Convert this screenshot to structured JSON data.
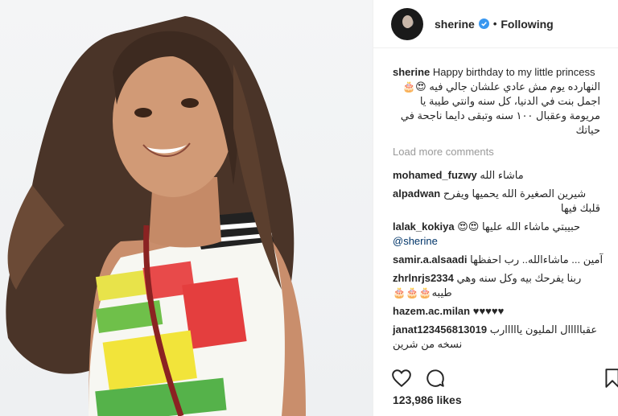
{
  "header": {
    "username": "sherine",
    "separator": "•",
    "follow_status": "Following",
    "verified_icon": "verified-badge-icon",
    "accent_color": "#3897f0"
  },
  "caption": {
    "username": "sherine",
    "line1": "Happy birthday to my little princess",
    "arabic_lines": [
      "النهارده يوم مش عادي علشان جالي فيه 😍🎂",
      "اجمل بنت في الدنيا، كل سنه وانتي طيبة يا",
      "مريومة وعقبال ١٠٠ سنه وتبقى دايما ناجحة في",
      "حياتك"
    ]
  },
  "load_more": "Load more comments",
  "comments": [
    {
      "user": "mohamed_fuzwy",
      "text": "ماشاء الله"
    },
    {
      "user": "alpadwan",
      "text": "شيرين الصغيرة الله يحميها ويفرح",
      "text2": "قلبك فيها"
    },
    {
      "user": "lalak_kokiya",
      "text": "حبيبتي ماشاء الله عليها 😍😍",
      "mention": "@sherine"
    },
    {
      "user": "samir.a.alsaadi",
      "text": "آمين ... ماشاءالله.. رب احفظها"
    },
    {
      "user": "zhrlnrjs2334",
      "text": "ربنا يفرحك بيه وكل سنه وهي",
      "text2": "🎂🎂🎂طيبه"
    },
    {
      "user": "hazem.ac.milan",
      "text": "♥♥♥♥♥"
    },
    {
      "user": "janat123456813019",
      "text": "عقبااااال المليون يااااارب",
      "text2": "نسخه من شرين"
    }
  ],
  "actions": {
    "like_icon": "heart-icon",
    "comment_icon": "comment-icon",
    "save_icon": "bookmark-icon"
  },
  "likes": "123,986 likes"
}
